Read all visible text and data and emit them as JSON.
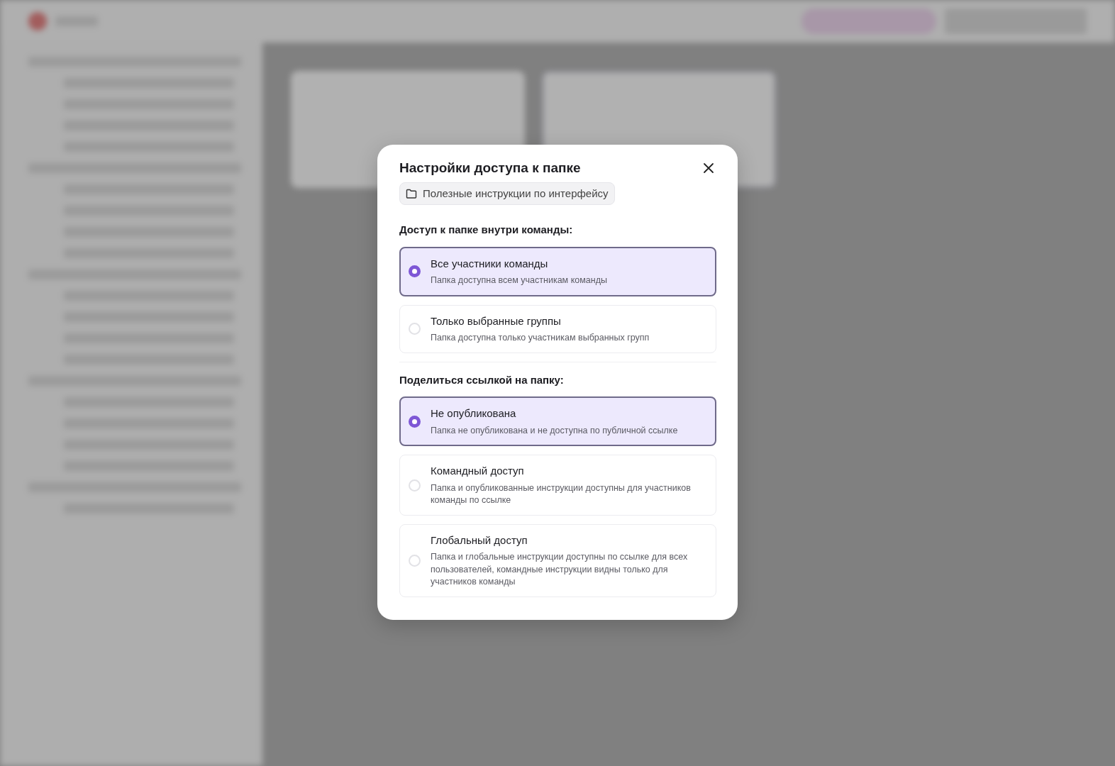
{
  "dialog": {
    "title": "Настройки доступа к папке",
    "folder": "Полезные инструкции по интерфейсу",
    "sections": [
      {
        "heading": "Доступ к папке внутри команды:",
        "options": [
          {
            "label": "Все участники команды",
            "description": "Папка доступна всем участникам команды",
            "selected": true
          },
          {
            "label": "Только выбранные группы",
            "description": "Папка доступна только участникам выбранных групп",
            "selected": false
          }
        ]
      },
      {
        "heading": "Поделиться ссылкой на папку:",
        "options": [
          {
            "label": "Не опубликована",
            "description": "Папка не опубликована и не доступна по публичной ссылке",
            "selected": true
          },
          {
            "label": "Командный доступ",
            "description": "Папка и опубликованные инструкции доступны для участников команды по ссылке",
            "selected": false
          },
          {
            "label": "Глобальный доступ",
            "description": "Папка и глобальные инструкции доступны по ссылке для всех пользователей, командные инструкции видны только для участников команды",
            "selected": false
          }
        ]
      }
    ]
  }
}
